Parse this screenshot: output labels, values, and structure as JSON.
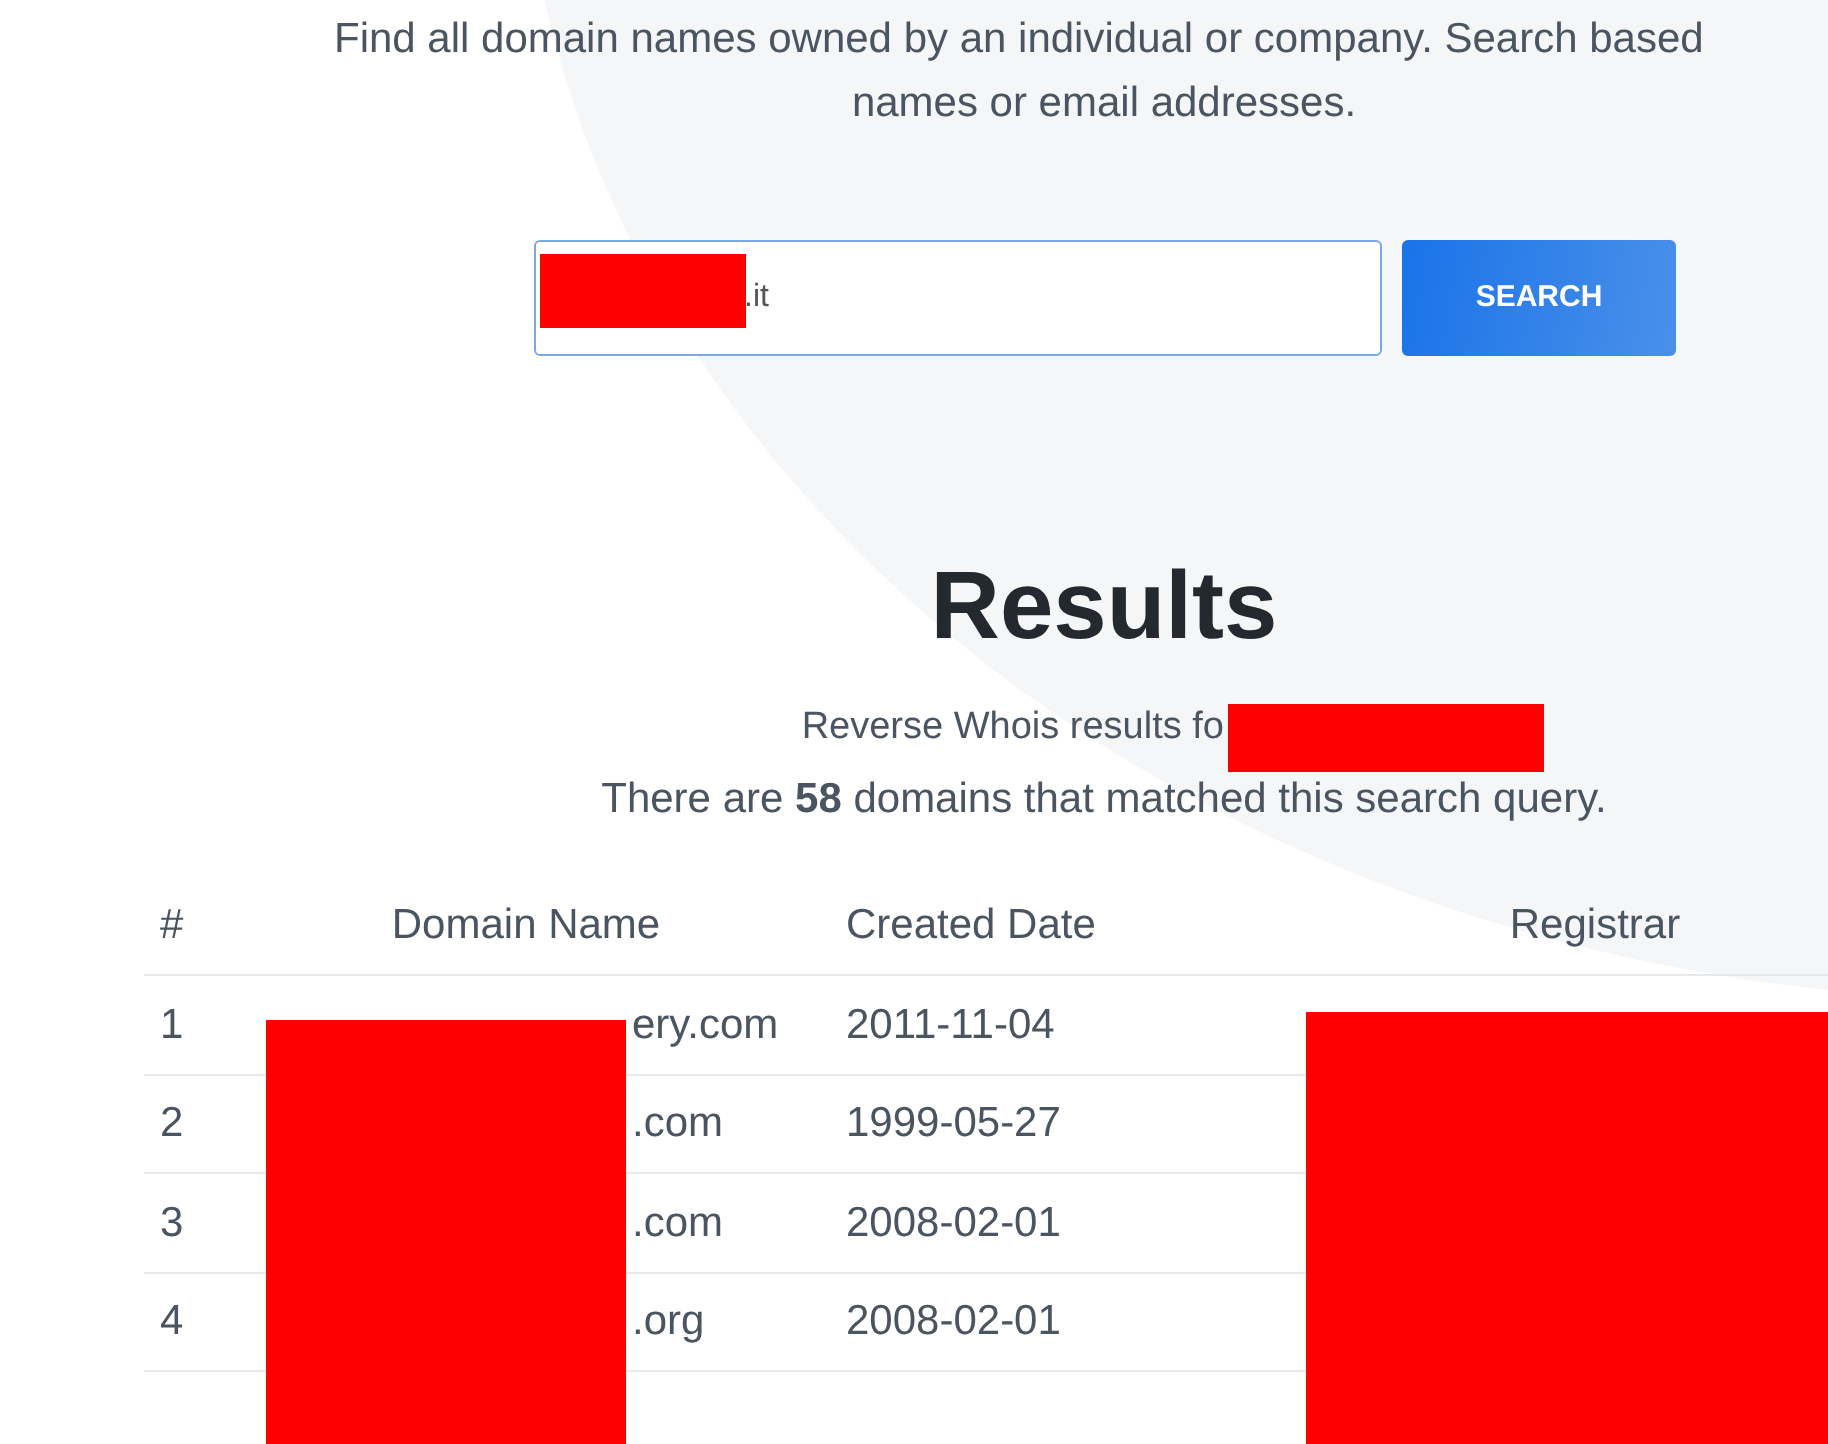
{
  "intro": {
    "line_1": "Find all domain names owned by an individual or company. Search based",
    "line_2": "names or email addresses."
  },
  "search": {
    "value": ".it",
    "button": "SEARCH"
  },
  "results": {
    "title": "Results",
    "subtitle": "Reverse Whois results fo",
    "summary": "There are **58** domains that matched this search query."
  },
  "table": {
    "columns": [
      "#",
      "Domain Name",
      "Created Date",
      "Registrar"
    ],
    "rows": [
      {
        "number": "1",
        "domain": "ery.com",
        "created": "2011-11-04"
      },
      {
        "number": "2",
        "domain": ".com",
        "created": "1999-05-27"
      },
      {
        "number": "3",
        "domain": ".com",
        "created": "2008-02-01"
      },
      {
        "number": "4",
        "domain": ".org",
        "created": "2008-02-01"
      }
    ]
  }
}
